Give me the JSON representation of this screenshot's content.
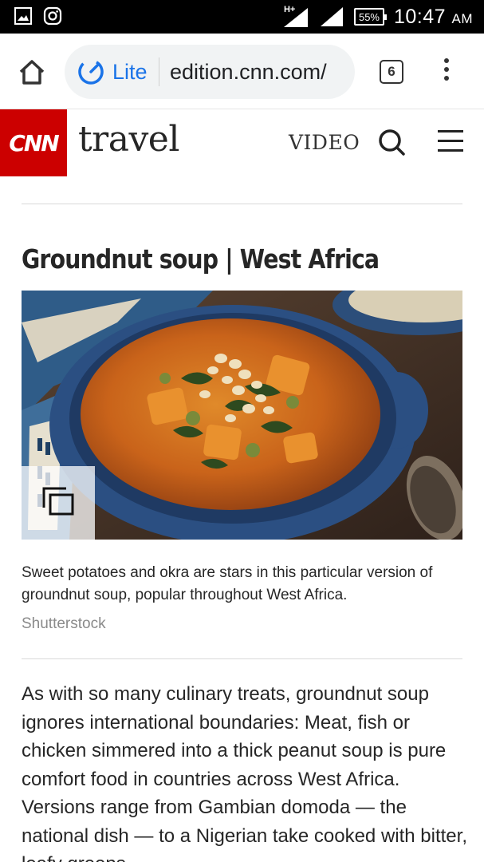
{
  "status_bar": {
    "network": "H+",
    "battery": "55%",
    "time": "10:47",
    "ampm": "AM"
  },
  "browser": {
    "lite_label": "Lite",
    "url": "edition.cnn.com/",
    "tab_count": "6"
  },
  "site": {
    "logo_text": "CNN",
    "section": "travel",
    "video_link": "VIDEO"
  },
  "article": {
    "title": "Groundnut soup | West Africa",
    "caption": "Sweet potatoes and okra are stars in this particular version of groundnut soup, popular throughout West Africa.",
    "credit": "Shutterstock",
    "body": "As with so many culinary treats, groundnut soup ignores international boundaries: Meat, fish or chicken simmered into a thick peanut soup is pure comfort food in countries across West Africa. Versions range from Gambian domoda — the national dish — to a Nigerian take cooked with bitter, leafy greens."
  },
  "colors": {
    "cnn_red": "#cc0000",
    "lite_blue": "#1a73e8",
    "status_bar": "#000000"
  }
}
